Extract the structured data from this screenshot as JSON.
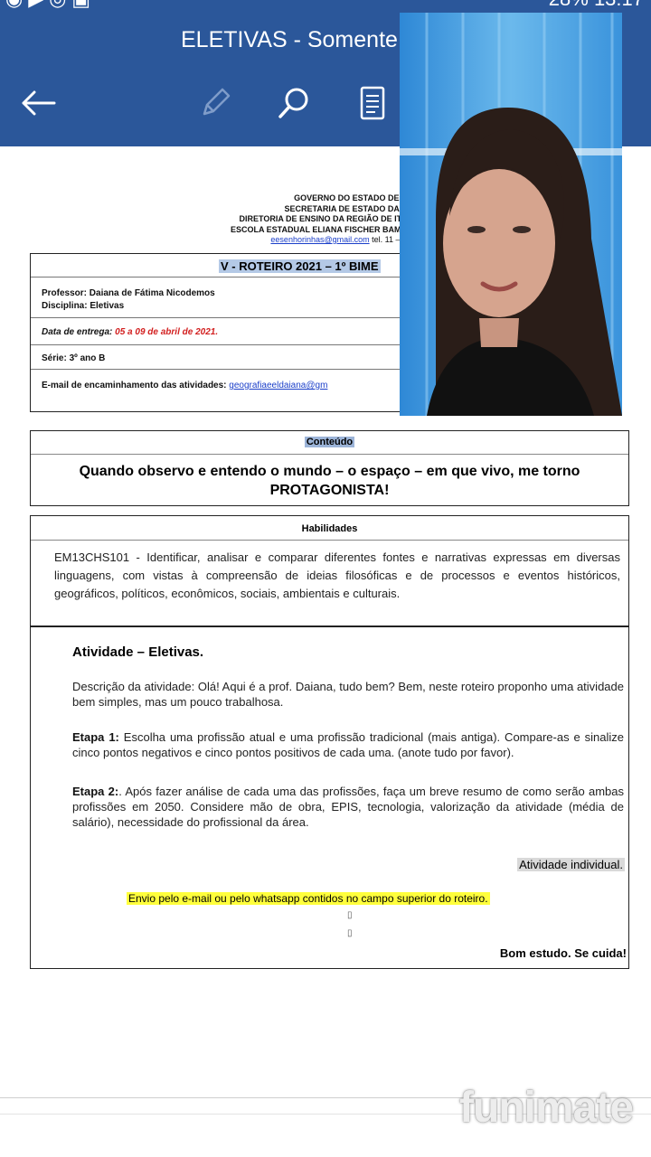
{
  "status_bar": {
    "battery": "28%",
    "time": "13:17"
  },
  "app_bar": {
    "title": "ELETIVAS - Somente"
  },
  "doc": {
    "header_lines": [
      "GOVERNO DO ESTADO DE S",
      "SECRETARIA DE ESTADO DA E",
      "DIRETORIA DE ENSINO DA REGIÃO DE ITA",
      "ESCOLA ESTADUAL ELIANA FISCHER BAMB"
    ],
    "header_email": "eesenhorinhas@gmail.com",
    "header_tel": " tel. 11 – 4",
    "roteiro_title": "V - ROTEIRO 2021 – 1º BIME",
    "professor": "Professor: Daiana de Fátima Nicodemos",
    "disciplina": "Disciplina: Eletivas",
    "entrega_label": "Data de entrega: ",
    "entrega_value": "05 a 09 de abril de 2021.",
    "serie": "Série: 3º ano B",
    "email_label": "E-mail de encaminhamento das atividades: ",
    "email_value": "geografiaeeldaiana@gm",
    "conteudo_label": "Conteúdo",
    "conteudo_text": "Quando observo e entendo o mundo – o espaço – em que vivo, me torno PROTAGONISTA!",
    "habilidades_label": "Habilidades",
    "habilidades_text": "EM13CHS101 - Identificar, analisar e comparar diferentes fontes e narrativas expressas em diversas linguagens, com vistas à compreensão de ideias filosóficas e de processos e eventos históricos, geográficos, políticos, econômicos, sociais, ambientais e culturais.",
    "atividade_title": "Atividade – Eletivas.",
    "descricao": "Descrição da atividade: Olá! Aqui é a prof. Daiana, tudo bem? Bem, neste roteiro proponho uma atividade bem simples, mas um pouco trabalhosa.",
    "etapa1_label": "Etapa 1:",
    "etapa1_text": " Escolha uma profissão atual e uma profissão tradicional (mais antiga). Compare-as e sinalize cinco pontos negativos e cinco pontos positivos de cada uma. (anote tudo por favor).",
    "etapa2_label": "Etapa 2:",
    "etapa2_text": ". Após fazer análise de cada uma das profissões, faça um breve resumo de como serão ambas profissões em 2050. Considere mão de obra, EPIS, tecnologia, valorização da atividade (média de salário), necessidade do profissional da área.",
    "individual": "Atividade individual.",
    "envio": "Envio pelo e-mail ou pelo whatsapp contidos no campo superior do roteiro.",
    "glyph": "▯",
    "bom_estudo": "Bom estudo. Se cuida!"
  },
  "watermark": "funimate",
  "colors": {
    "app_bar": "#2b579a",
    "highlight_yellow": "#ffff3c",
    "red_date": "#d21f1f",
    "link": "#1a3ec9"
  },
  "icons": [
    "back-arrow-icon",
    "edit-pencil-icon",
    "search-icon",
    "reading-view-icon"
  ]
}
